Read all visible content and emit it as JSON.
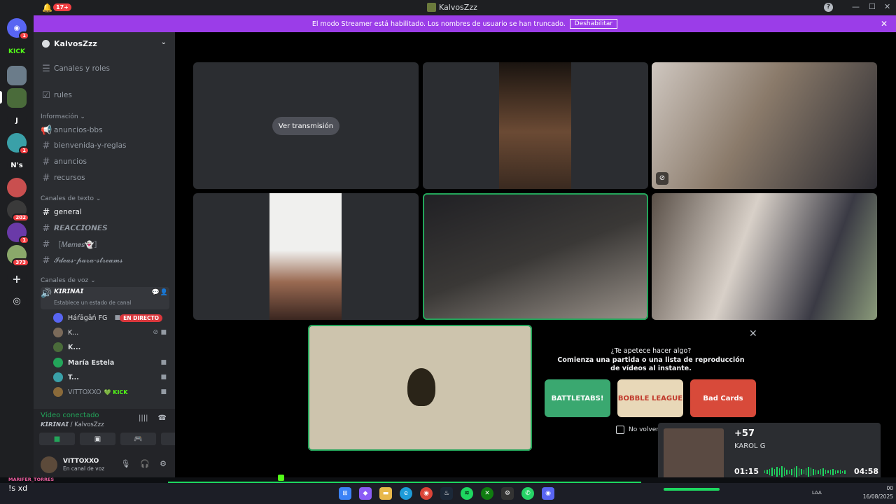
{
  "window": {
    "title": "KalvosZzz",
    "notification_count": "17+"
  },
  "banner": {
    "text": "El modo Streamer está habilitado. Los nombres de usuario se han truncado.",
    "button": "Deshabilitar"
  },
  "rail": {
    "servers": [
      {
        "label": "",
        "badge": "1",
        "color": "#5865f2"
      },
      {
        "label": "KICK",
        "badge": "",
        "color": "#1e1f22"
      },
      {
        "label": "",
        "badge": "",
        "color": "#6b7c8a"
      },
      {
        "label": "",
        "badge": "",
        "color": "#4a6b3a"
      },
      {
        "label": "J",
        "badge": "",
        "color": "#1e1f22"
      },
      {
        "label": "",
        "badge": "1",
        "color": "#3aa0a8"
      },
      {
        "label": "N's",
        "badge": "",
        "color": "#1e1f22"
      },
      {
        "label": "",
        "badge": "",
        "color": "#c94f4f"
      },
      {
        "label": "",
        "badge": "202",
        "color": "#3a3a3a"
      },
      {
        "label": "",
        "badge": "1",
        "color": "#6a3aa8"
      },
      {
        "label": "",
        "badge": "373",
        "color": "#8aa86a"
      }
    ]
  },
  "sidebar": {
    "server_name": "KalvosZzz",
    "top_items": [
      {
        "label": "Canales y roles"
      },
      {
        "label": "rules"
      }
    ],
    "categories": {
      "info": "Información",
      "text": "Canales de texto",
      "voice": "Canales de voz"
    },
    "info_channels": [
      {
        "label": "anuncios-bbs"
      },
      {
        "label": "bienvenida-y-reglas"
      },
      {
        "label": "anuncios"
      },
      {
        "label": "recursos"
      }
    ],
    "text_channels": [
      {
        "label": "general"
      },
      {
        "label": "𝙍𝙀𝘼𝘾𝘾𝙄𝙊𝙉𝙀𝙎"
      },
      {
        "label": "［𝑀𝑒𝑚𝑒𝑠👻］"
      },
      {
        "label": "𝓘𝓭𝓮𝓪𝓼-𝓹𝓪𝓻𝓪-𝓼𝓽𝓻𝓮𝓪𝓶𝓼"
      }
    ],
    "voice_channel": {
      "name": "𝙆𝙄𝙍𝙄𝙉𝘼𝙄",
      "status_placeholder": "Establece un estado de canal"
    },
    "voice_users": [
      {
        "name": "Háŕāgāń FG",
        "live": "EN DIRECTO",
        "color": "#5865f2"
      },
      {
        "name": "K...",
        "live": "",
        "color": "#7a6a5a"
      },
      {
        "name": "K...",
        "live": "",
        "color": "#4a6b3a"
      },
      {
        "name": "María Estela",
        "live": "",
        "color": "#23a55a"
      },
      {
        "name": "T...",
        "live": "",
        "color": "#3aa0a8"
      },
      {
        "name": "VITTOXXO",
        "live": "",
        "color": "#8a6a3a",
        "tag": "KICK"
      }
    ]
  },
  "voice_panel": {
    "title": "Vídeo conectado",
    "subtitle": "𝙆𝙄𝙍𝙄𝙉𝘼𝙄 / KalvosZzz"
  },
  "user_panel": {
    "name": "VITTOXXO",
    "status": "En canal de voz"
  },
  "video": {
    "watch_stream_label": "Ver transmisión"
  },
  "activity": {
    "question": "¿Te apetece hacer algo?",
    "description": "Comienza una partida o una lista de reproducción de vídeos al instante.",
    "games": [
      {
        "name": "BATTLETABS!",
        "color": "#3aa870"
      },
      {
        "name": "BOBBLE LEAGUE",
        "color": "#e8d8b8"
      },
      {
        "name": "Bad Cards",
        "color": "#d84a3a"
      }
    ],
    "dont_show": "No volver a m"
  },
  "spotify": {
    "count": "+57",
    "name": "KAROL G",
    "elapsed": "01:15",
    "duration": "04:58"
  },
  "chat": {
    "username": "MARIFER_TORRES",
    "message": "!s xd"
  },
  "taskbar": {
    "tray_lang": "LAA",
    "time": "00",
    "date": "16/08/2025"
  }
}
